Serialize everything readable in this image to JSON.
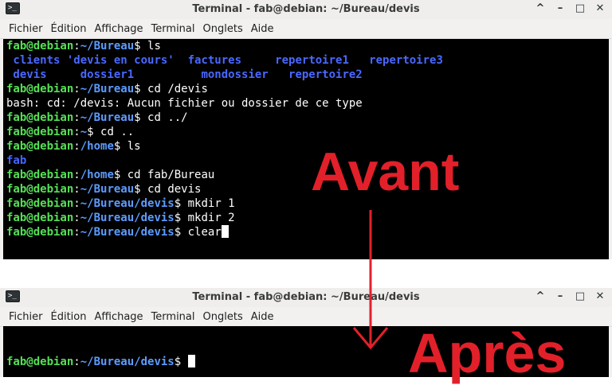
{
  "colors": {
    "terminal_bg": "#000000",
    "user_host": "#55e055",
    "path": "#5c9cff",
    "directory": "#4466ff",
    "annotation_red": "#e2202a"
  },
  "icons": {
    "app": "terminal-icon",
    "minimize": "minimize-icon",
    "maximize": "maximize-icon",
    "close": "close-icon"
  },
  "top_window": {
    "app_icon_glyph": ">_",
    "title": "Terminal - fab@debian: ~/Bureau/devis",
    "controls": {
      "chevron": "^",
      "minimize": "–",
      "maximize": "□",
      "close": "✕"
    },
    "menu": [
      "Fichier",
      "Édition",
      "Affichage",
      "Terminal",
      "Onglets",
      "Aide"
    ],
    "terminal": {
      "user_host": "fab@debian",
      "colon": ":",
      "lines": [
        {
          "path": "~/Bureau",
          "cmd": "$ ls"
        },
        {
          "ls_row": [
            " clients",
            " 'devis en cours'",
            "  factures",
            "     repertoire1",
            "   repertoire3"
          ]
        },
        {
          "ls_row": [
            " devis",
            "     dossier1",
            "          mondossier",
            "   repertoire2"
          ]
        },
        {
          "path": "~/Bureau",
          "cmd": "$ cd /devis"
        },
        {
          "output": "bash: cd: /devis: Aucun fichier ou dossier de ce type"
        },
        {
          "path": "~/Bureau",
          "cmd": "$ cd ../"
        },
        {
          "path": "~",
          "cmd": "$ cd .."
        },
        {
          "path": "/home",
          "cmd": "$ ls"
        },
        {
          "dir_output": "fab"
        },
        {
          "path": "/home",
          "cmd": "$ cd fab/Bureau"
        },
        {
          "path": "~/Bureau",
          "cmd": "$ cd devis"
        },
        {
          "path": "~/Bureau/devis",
          "cmd": "$ mkdir 1"
        },
        {
          "path": "~/Bureau/devis",
          "cmd": "$ mkdir 2"
        },
        {
          "path": "~/Bureau/devis",
          "cmd": "$ clear",
          "cursor": true
        }
      ]
    }
  },
  "bottom_window": {
    "app_icon_glyph": ">_",
    "title": "Terminal - fab@debian: ~/Bureau/devis",
    "controls": {
      "chevron": "^",
      "minimize": "–",
      "maximize": "□",
      "close": "✕"
    },
    "menu": [
      "Fichier",
      "Édition",
      "Affichage",
      "Terminal",
      "Onglets",
      "Aide"
    ],
    "terminal": {
      "user_host": "fab@debian",
      "colon": ":",
      "path": "~/Bureau/devis",
      "cmd": "$ "
    }
  },
  "annotations": {
    "before": "Avant",
    "after": "Après"
  }
}
